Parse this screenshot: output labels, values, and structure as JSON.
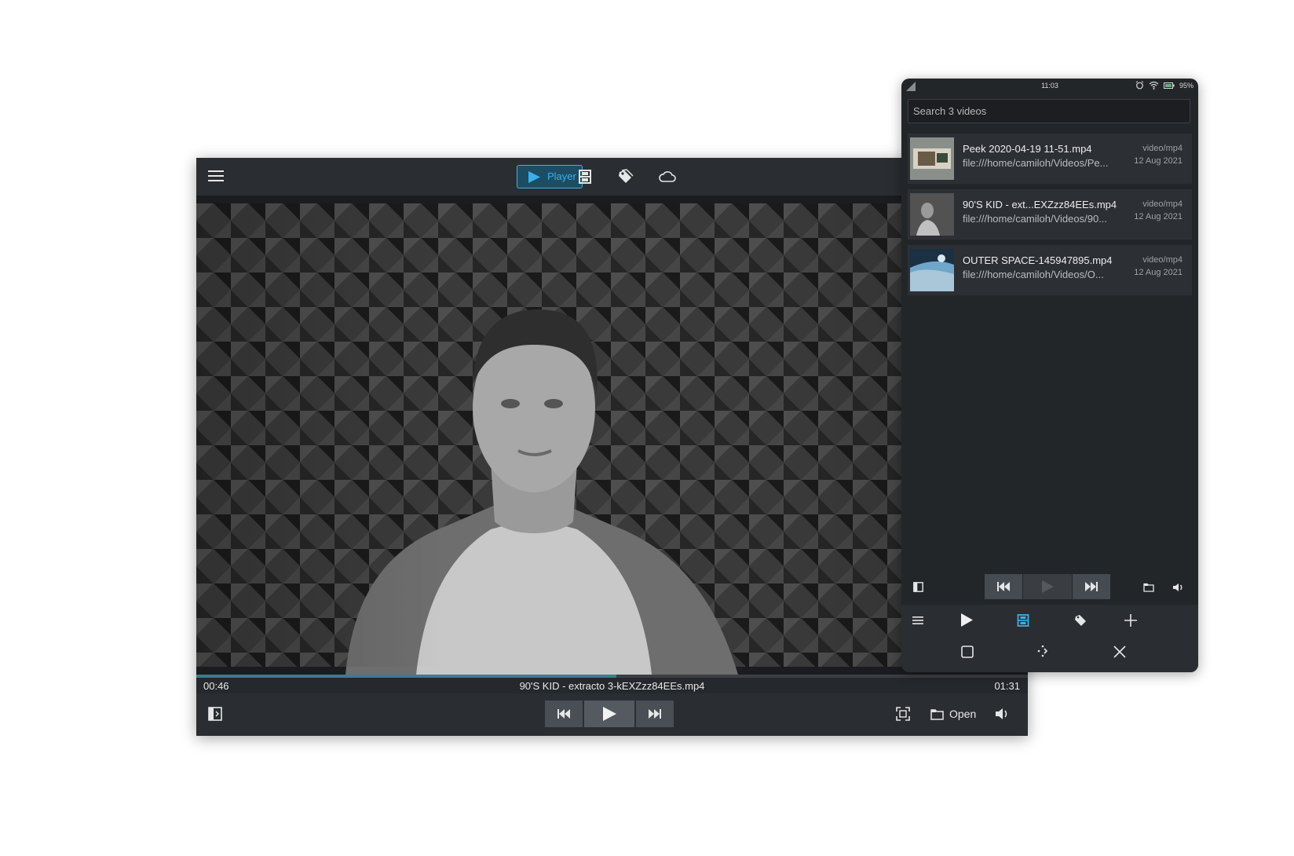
{
  "desktop": {
    "tabs": {
      "player_label": "Player",
      "player_icon": "play-icon",
      "videos_icon": "film-strip-icon",
      "tags_icon": "tags-icon",
      "cloud_icon": "cloud-icon"
    },
    "player": {
      "elapsed": "00:46",
      "duration": "01:31",
      "title": "90'S KID - extracto 3-kEXZzz84EEs.mp4",
      "progress_fraction": 0.505
    },
    "controls": {
      "open_label": "Open"
    }
  },
  "phone": {
    "status": {
      "time": "11:03",
      "battery": "95%"
    },
    "search": {
      "placeholder": "Search 3 videos"
    },
    "videos": [
      {
        "name": "Peek 2020-04-19 11-51.mp4",
        "path": "file:///home/camiloh/Videos/Pe...",
        "mime": "video/mp4",
        "date": "12 Aug 2021"
      },
      {
        "name": "90'S KID - ext...EXZzz84EEs.mp4",
        "path": "file:///home/camiloh/Videos/90...",
        "mime": "video/mp4",
        "date": "12 Aug 2021"
      },
      {
        "name": "OUTER SPACE-145947895.mp4",
        "path": "file:///home/camiloh/Videos/O...",
        "mime": "video/mp4",
        "date": "12 Aug 2021"
      }
    ]
  },
  "colors": {
    "accent": "#3daee9",
    "window_bg": "#25282c",
    "progress": "#3a7e8c"
  }
}
